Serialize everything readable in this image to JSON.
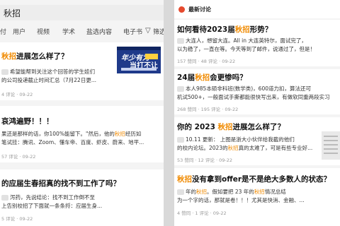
{
  "left": {
    "search": {
      "query": "秋招"
    },
    "tabs": [
      "付",
      "用户",
      "视频",
      "学术",
      "盐选内容",
      "电子书",
      "筛选"
    ],
    "cards": [
      {
        "title_hl": "秋招",
        "title_rest": "进展怎么样了？",
        "body_lines": [
          "希望能帮到关注这个回答的学生娃们",
          "的公司投递截止时间汇总（7月22日更..."
        ],
        "meta": "4 评论 · 09-22",
        "thumb": {
          "line1": "年少有为",
          "line2": "当打不让",
          "badge": "Offer"
        }
      },
      {
        "title": "哀鸿遍野！！！",
        "body_lines": [
          "果还是那样的话，你100%能留下。\"然后，他的秋招经历如",
          "笔试挂：腾讯、Zoom、懂车帝、百度、虾皮、蔚来、地平..."
        ],
        "body_hl_word": "秋招",
        "meta": "57 评论 · 09-22"
      },
      {
        "title": "的应届生春招真的找不到工作了吗？",
        "body_lines": [
          "泻药，先说结论：找不到工作倒不至",
          "上告别校招了下面就一条条捋：应届生身..."
        ],
        "meta": "5 评论 · 09-22"
      }
    ]
  },
  "right": {
    "header_label": "最新讨论",
    "cards": [
      {
        "title_pre": "如何看待2023届",
        "title_hl": "秋招",
        "title_post": "形势？",
        "body_lines": [
          "大连人，想留大连。All in 大连英特尔，面试完了，",
          "以为稳了，一直在等。今天等到了邮件，说通过了，但是！"
        ],
        "meta": "157 赞同 · 48 评论 · 09-22"
      },
      {
        "title_pre": "24届",
        "title_hl": "秋招",
        "title_post": "会更惨吗？",
        "body_lines": [
          "本人985本硕非科班(数学类)，600道力扣，算法还可",
          "机试500+，一般面试手撕都能很快写出来，有做软同重两段实习"
        ],
        "meta": "268 赞同 · 195 评论 · 09-22"
      },
      {
        "title_pre": "你的 2023 ",
        "title_hl": "秋招",
        "title_post": "进展怎么样了？",
        "body_lines": [
          "10.11 更新： 上图是浙大小伙伴给我截的他们",
          "的校内论坛。2023的秋招真的太难了，可是有些专业好..."
        ],
        "meta": "53 赞同 · 12 评论 · 09-22"
      },
      {
        "title_hl": "秋招",
        "title_rest": "没有拿到offer是不是绝大多数人的状态？",
        "body_lines": [
          "年的秋招。假如要把 23 年的秋招情况总结",
          "为一个字的话，那就是卷！！！尤其是快消、金融、..."
        ],
        "meta": "4 赞同 · 1 评论 · 09-22"
      }
    ]
  }
}
